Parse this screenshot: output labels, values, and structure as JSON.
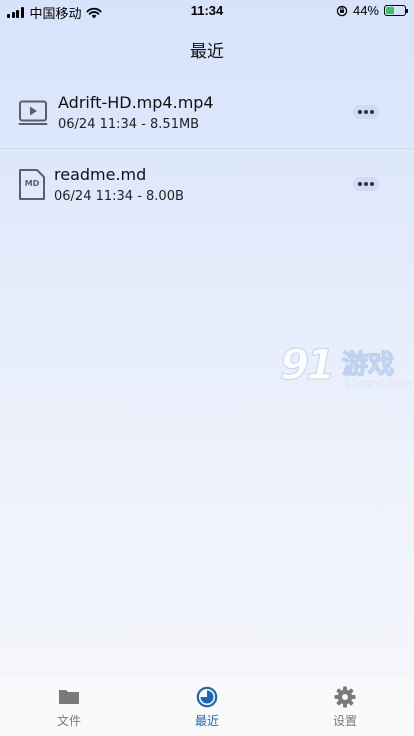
{
  "status_bar": {
    "carrier": "中国移动",
    "time": "11:34",
    "battery_percent": "44%",
    "battery_level": 0.44
  },
  "header": {
    "title": "最近"
  },
  "files": [
    {
      "name": "Adrift-HD.mp4.mp4",
      "meta": "06/24 11:34 - 8.51MB",
      "icon": "video-file-icon",
      "badge": ""
    },
    {
      "name": "readme.md",
      "meta": "06/24 11:34 - 8.00B",
      "icon": "markdown-file-icon",
      "badge": "MD"
    }
  ],
  "watermark": {
    "logo": "91游戏",
    "url": "91danji.com"
  },
  "tabs": [
    {
      "label": "文件",
      "icon": "folder-icon",
      "active": false
    },
    {
      "label": "最近",
      "icon": "recent-icon",
      "active": true
    },
    {
      "label": "设置",
      "icon": "gear-icon",
      "active": false
    }
  ],
  "colors": {
    "accent": "#1d67b8",
    "tab_inactive": "#7a7a7a",
    "battery": "#34c759"
  }
}
